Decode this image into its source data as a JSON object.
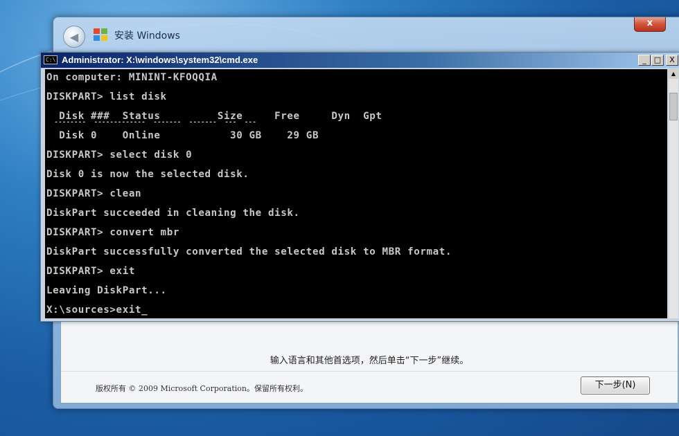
{
  "setup_window": {
    "title": "安装 Windows",
    "close_label": "x",
    "back_label": "◀",
    "instruction": "输入语言和其他首选项，然后单击“下一步”继续。",
    "copyright": "版权所有 © 2009 Microsoft Corporation。保留所有权利。",
    "next_button": "下一步(N)",
    "colors": {
      "logo_red": "#e8472b",
      "logo_green": "#6cb33f",
      "logo_blue": "#2f8de4",
      "logo_yellow": "#f5c417"
    }
  },
  "cmd_window": {
    "title": "Administrator: X:\\windows\\system32\\cmd.exe",
    "icon_text": "C:\\",
    "controls": {
      "minimize": "_",
      "maximize": "□",
      "close": "X"
    },
    "lines": [
      "On computer: MININT-KFOQQIA",
      "DISKPART> list disk",
      "  Disk ###  Status         Size     Free     Dyn  Gpt",
      "  --------  -------------  -------  -------  ---  ---",
      "  Disk 0    Online           30 GB    29 GB",
      "DISKPART> select disk 0",
      "Disk 0 is now the selected disk.",
      "DISKPART> clean",
      "DiskPart succeeded in cleaning the disk.",
      "DISKPART> convert mbr",
      "DiskPart successfully converted the selected disk to MBR format.",
      "DISKPART> exit",
      "Leaving DiskPart...",
      "X:\\sources>exit_"
    ]
  }
}
